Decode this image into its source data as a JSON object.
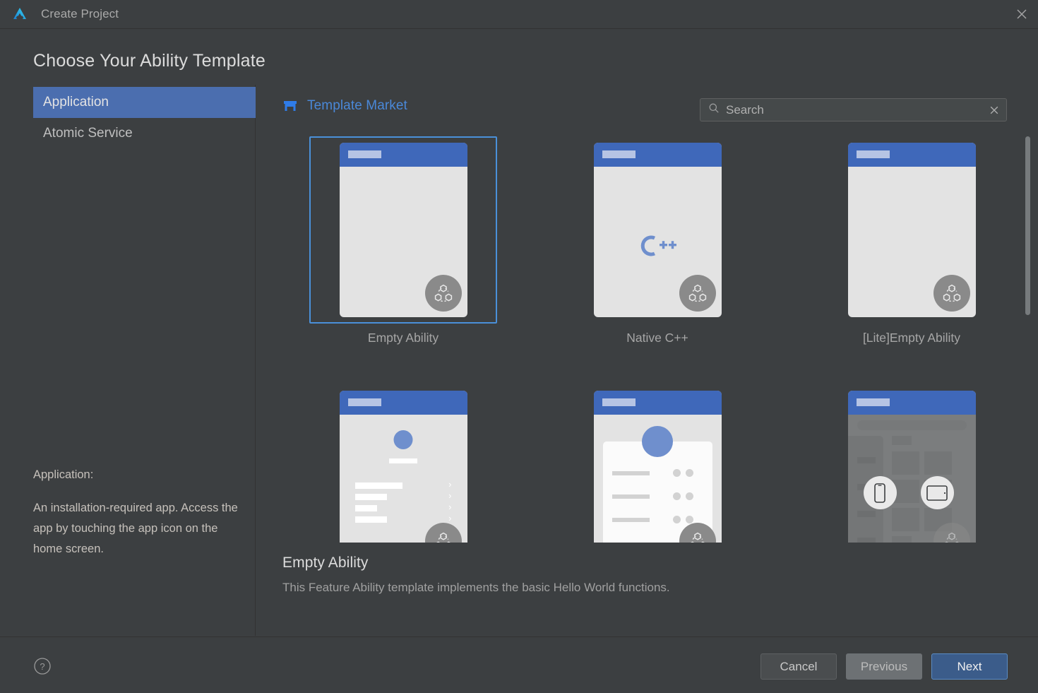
{
  "window": {
    "title": "Create Project",
    "logo_icon": "deveco-logo-icon",
    "close_icon": "close-icon"
  },
  "page": {
    "heading": "Choose Your Ability Template"
  },
  "sidebar": {
    "items": [
      {
        "label": "Application",
        "selected": true
      },
      {
        "label": "Atomic Service",
        "selected": false
      }
    ],
    "description": {
      "lead": "Application:",
      "body": "An installation-required app. Access the app by touching the app icon on the home screen."
    }
  },
  "toolbar": {
    "market_label": "Template Market",
    "market_icon": "shop-icon"
  },
  "search": {
    "placeholder": "Search",
    "value": "",
    "icon": "search-icon",
    "clear_icon": "close-icon"
  },
  "templates": [
    {
      "label": "Empty Ability",
      "kind": "blank",
      "selected": true,
      "dimmed": false
    },
    {
      "label": "Native C++",
      "kind": "cpp",
      "selected": false,
      "dimmed": false,
      "logo_text": "C++"
    },
    {
      "label": "[Lite]Empty Ability",
      "kind": "blank",
      "selected": false,
      "dimmed": false
    },
    {
      "label": "",
      "kind": "settings-list",
      "selected": false,
      "dimmed": false
    },
    {
      "label": "",
      "kind": "card-list",
      "selected": false,
      "dimmed": false
    },
    {
      "label": "",
      "kind": "device-picker",
      "selected": false,
      "dimmed": true
    }
  ],
  "selection": {
    "title": "Empty Ability",
    "description": "This Feature Ability template implements the basic Hello World functions."
  },
  "footer": {
    "help_icon": "help-circle-icon",
    "cancel_label": "Cancel",
    "previous_label": "Previous",
    "next_label": "Next"
  },
  "colors": {
    "window_bg": "#3c3f41",
    "accent_blue": "#4a88d8",
    "selection_blue": "#4b6eaf",
    "primary_button": "#3b5c8a",
    "card_header_blue": "#3f68ba"
  }
}
